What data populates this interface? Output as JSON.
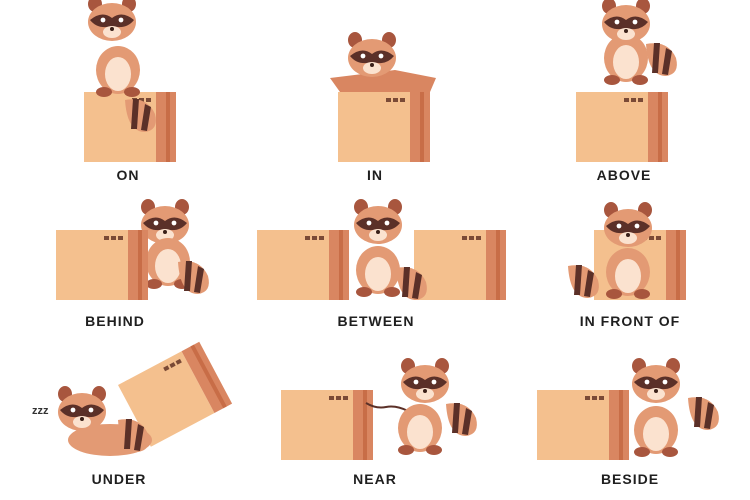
{
  "scenes": [
    {
      "label": "ON"
    },
    {
      "label": "IN"
    },
    {
      "label": "ABOVE"
    },
    {
      "label": "BEHIND"
    },
    {
      "label": "BETWEEN"
    },
    {
      "label": "IN FRONT OF"
    },
    {
      "label": "UNDER"
    },
    {
      "label": "NEAR"
    },
    {
      "label": "BESIDE"
    }
  ],
  "sleep_text": "zzz",
  "colors": {
    "box_light": "#f4c08e",
    "box_side": "#d98661",
    "box_edge": "#c86d47",
    "fur": "#e39a74",
    "fur_dark": "#a8563e",
    "mask": "#5b3028",
    "belly": "#fbe2cf"
  }
}
